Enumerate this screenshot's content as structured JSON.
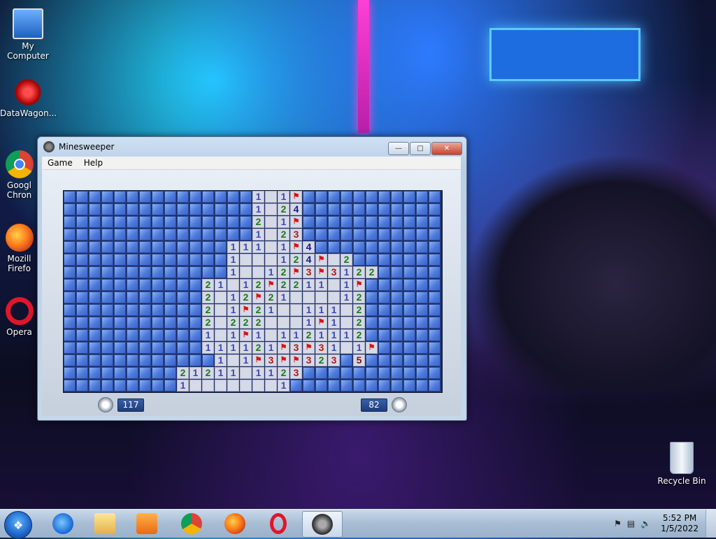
{
  "desktop": {
    "icons": [
      {
        "label": "My Computer",
        "icon": "computer-icon"
      },
      {
        "label": "DataWagon...",
        "icon": "datawagon-icon"
      },
      {
        "label": "Googl\nChron",
        "icon": "chrome-icon"
      },
      {
        "label": "Mozill\nFirefo",
        "icon": "firefox-icon"
      },
      {
        "label": "Opera",
        "icon": "opera-icon"
      },
      {
        "label": "Recycle Bin",
        "icon": "recycle-bin-icon"
      }
    ]
  },
  "window": {
    "title": "Minesweeper",
    "menu": [
      "Game",
      "Help"
    ],
    "timer": "117",
    "mines_left": "82"
  },
  "board": {
    "rows": 16,
    "cols": 30,
    "grid": [
      "CCCCCCCCCCCCCCC1_1FCCCCCCCCCCC",
      "CCCCCCCCCCCCCCC1_24CCCCCCCCCCC",
      "CCCCCCCCCCCCCCC2_1FCCCCCCCCCCC",
      "CCCCCCCCCCCCCCC1_23CCCCCCCCCCC",
      "CCCCCCCCCCCCC111_1F4CCCCCCCCCC",
      "CCCCCCCCCCCCC1___124F_2CCCCCCC",
      "CCCCCCCCCCCCC1__12F3F3122CCCCC",
      "CCCCCCCCCCC21_12F2211_1FCCCCCC",
      "CCCCCCCCCCC2_12F21____12CCCCCC",
      "CCCCCCCCCCC2_1F21__111_2CCCCCC",
      "CCCCCCCCCCC2_222___1F1_2CCCCCC",
      "CCCCCCCCCCC1_1F1_1121112CCCCCC",
      "CCCCCCCCCCC111121F3F31_1FCCCCC",
      "CCCCCCCCCCCC1_1F3FF323C5CCCCCC",
      "CCCCCCCCC21211_1123CCCCCCCCCCC",
      "CCCCCCCCC1_______1CCCCCCCCCCCC"
    ]
  },
  "taskbar": {
    "items": [
      "ie-icon",
      "explorer-icon",
      "media-player-icon",
      "chrome-icon",
      "firefox-icon",
      "opera-icon",
      "minesweeper-icon"
    ],
    "time": "5:52 PM",
    "date": "1/5/2022"
  }
}
